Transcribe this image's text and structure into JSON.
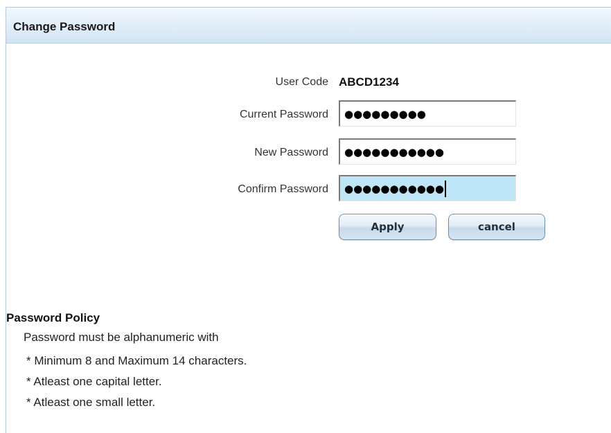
{
  "header": {
    "title": "Change Password"
  },
  "form": {
    "user_code_label": "User Code",
    "user_code_value": "ABCD1234",
    "current_password_label": "Current Password",
    "current_password_value": "●●●●●●●●●",
    "new_password_label": "New Password",
    "new_password_value": "●●●●●●●●●●●",
    "confirm_password_label": "Confirm Password",
    "confirm_password_value": "●●●●●●●●●●●",
    "apply_label": "Apply",
    "cancel_label": "cancel"
  },
  "policy": {
    "title": "Password Policy",
    "intro": "Password must be alphanumeric with",
    "rules": [
      "* Minimum 8 and Maximum 14 characters.",
      "* Atleast one capital letter.",
      "* Atleast one small letter."
    ]
  },
  "colors": {
    "header_gradient_bottom": "#d2e4f2",
    "focused_field_bg": "#bfe6f7",
    "button_border": "#6f8ea8"
  }
}
